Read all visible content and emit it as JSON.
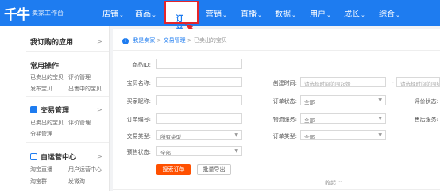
{
  "app": {
    "logo": "千牛",
    "subtitle": "卖家工作台"
  },
  "nav": {
    "items": [
      {
        "label": "店铺"
      },
      {
        "label": "商品"
      },
      {
        "label": "订单"
      },
      {
        "label": "营销"
      },
      {
        "label": "直播"
      },
      {
        "label": "数据"
      },
      {
        "label": "用户"
      },
      {
        "label": "成长"
      },
      {
        "label": "综合"
      }
    ],
    "chevron": "⌄",
    "active_index": 2,
    "highlight_color": "#e5252a"
  },
  "sidebar": {
    "my_apps": "我订购的应用",
    "common_ops": "常用操作",
    "common_links": [
      "已卖出的宝贝",
      "评价管理",
      "发布宝贝",
      "出售中的宝贝"
    ],
    "trade_mgmt": "交易管理",
    "trade_links": [
      "已卖出的宝贝",
      "评价管理",
      "分期管理"
    ],
    "self_ops": "自运营中心",
    "self_links": [
      "淘宝直播",
      "用户运营中心",
      "淘宝群",
      "发微淘"
    ],
    "arrow": ">"
  },
  "breadcrumb": {
    "items": [
      "我是卖家",
      "交易管理",
      "已卖出的宝贝"
    ],
    "sep": ">"
  },
  "form": {
    "product_id": "商品ID:",
    "item_name": "宝贝名称:",
    "buyer_nick": "买家昵称:",
    "order_no": "订单编号:",
    "trade_type": "交易类型:",
    "trade_type_value": "所有类型",
    "presale_status": "预售状态:",
    "presale_value": "全部",
    "created_time": "创建时间:",
    "date_placeholder_start": "请选择时间范围起始",
    "date_dash": "-",
    "date_placeholder_end": "请选择时间范围结束",
    "order_status": "订单状态:",
    "order_status_value": "全部",
    "logistics": "物流服务:",
    "logistics_value": "全部",
    "order_type": "订单类型:",
    "order_type_value": "全部",
    "review_status": "评价状态:",
    "after_sales": "售后服务:",
    "search_btn": "搜索订单",
    "export_btn": "批量导出",
    "collapse": "收起 ⌃"
  },
  "colors": {
    "accent": "#1e7cf0",
    "primary_btn": "#ff5000"
  }
}
